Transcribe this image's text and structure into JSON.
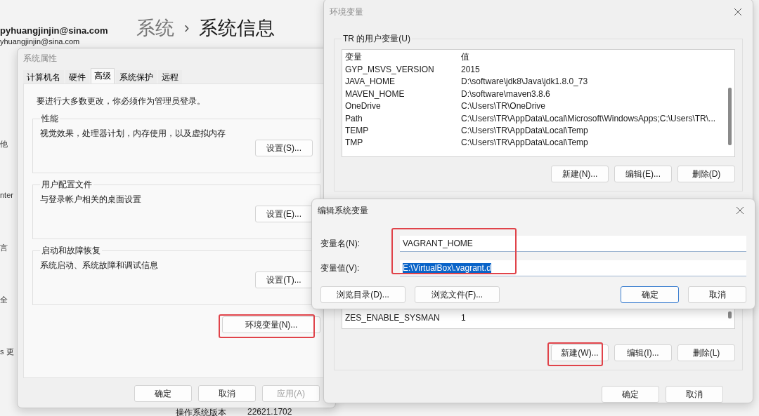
{
  "background": {
    "account_name": "pyhuangjinjin@sina.com",
    "account_email": "yhuangjinjin@sina.com",
    "breadcrumb": [
      {
        "label": "系统",
        "current": false
      },
      {
        "label": "系统信息",
        "current": true
      }
    ],
    "separator": "›",
    "sidebar_fragments": [
      "他",
      "nter",
      "言",
      "全",
      "s 更"
    ],
    "info_row": {
      "label": "操作系统版本",
      "value": "22621.1702"
    }
  },
  "system_properties": {
    "title": "系统属性",
    "active": false,
    "tabs": [
      {
        "label": "计算机名",
        "selected": false
      },
      {
        "label": "硬件",
        "selected": false
      },
      {
        "label": "高级",
        "selected": true
      },
      {
        "label": "系统保护",
        "selected": false
      },
      {
        "label": "远程",
        "selected": false
      }
    ],
    "notice": "要进行大多数更改，你必须作为管理员登录。",
    "groups": [
      {
        "title": "性能",
        "description": "视觉效果，处理器计划，内存使用，以及虚拟内存",
        "button": "设置(S)..."
      },
      {
        "title": "用户配置文件",
        "description": "与登录帐户相关的桌面设置",
        "button": "设置(E)..."
      },
      {
        "title": "启动和故障恢复",
        "description": "系统启动、系统故障和调试信息",
        "button": "设置(T)..."
      }
    ],
    "env_button": {
      "label": "环境变量(N)...",
      "highlighted": true
    },
    "buttons": [
      {
        "label": "确定",
        "disabled": false
      },
      {
        "label": "取消",
        "disabled": false
      },
      {
        "label": "应用(A)",
        "disabled": true
      }
    ]
  },
  "environment_variables": {
    "title": "环境变量",
    "active": false,
    "user_group_title": "TR 的用户变量(U)",
    "columns": [
      "变量",
      "值"
    ],
    "user_rows": [
      {
        "name": "GYP_MSVS_VERSION",
        "value": "2015"
      },
      {
        "name": "JAVA_HOME",
        "value": "D:\\software\\jdk8\\Java\\jdk1.8.0_73"
      },
      {
        "name": "MAVEN_HOME",
        "value": "D:\\software\\maven3.8.6"
      },
      {
        "name": "OneDrive",
        "value": "C:\\Users\\TR\\OneDrive"
      },
      {
        "name": "Path",
        "value": "C:\\Users\\TR\\AppData\\Local\\Microsoft\\WindowsApps;C:\\Users\\TR\\..."
      },
      {
        "name": "TEMP",
        "value": "C:\\Users\\TR\\AppData\\Local\\Temp"
      },
      {
        "name": "TMP",
        "value": "C:\\Users\\TR\\AppData\\Local\\Temp"
      }
    ],
    "user_buttons": [
      {
        "label": "新建(N)...",
        "highlighted": false
      },
      {
        "label": "编辑(E)...",
        "highlighted": false
      },
      {
        "label": "删除(D)",
        "highlighted": false
      }
    ],
    "system_rows": [
      {
        "name": "ZES_ENABLE_SYSMAN",
        "value": "1"
      }
    ],
    "system_buttons": [
      {
        "label": "新建(W)...",
        "highlighted": true
      },
      {
        "label": "编辑(I)...",
        "highlighted": false
      },
      {
        "label": "删除(L)",
        "highlighted": false
      }
    ],
    "buttons": [
      {
        "label": "确定",
        "disabled": false
      },
      {
        "label": "取消",
        "disabled": false
      }
    ]
  },
  "edit_dialog": {
    "title": "编辑系统变量",
    "fields_highlighted": true,
    "fields": [
      {
        "label": "变量名(N):",
        "value": "VAGRANT_HOME",
        "selected": false
      },
      {
        "label": "变量值(V):",
        "value": "E:\\VirtualBox\\.vagrant.d",
        "selected": true
      }
    ],
    "browse_buttons": [
      {
        "label": "浏览目录(D)...",
        "default": false
      },
      {
        "label": "浏览文件(F)...",
        "default": false
      }
    ],
    "buttons": [
      {
        "label": "确定",
        "default": true
      },
      {
        "label": "取消",
        "default": false
      }
    ]
  }
}
